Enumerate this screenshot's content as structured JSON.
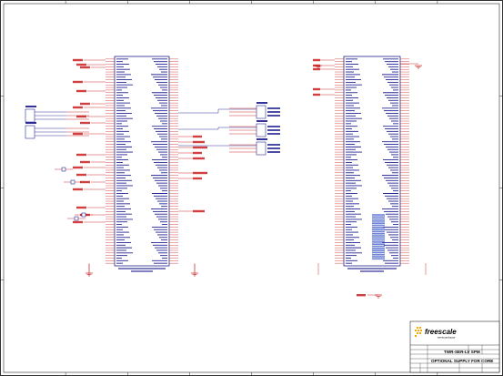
{
  "schematic": {
    "colors": {
      "border": "#000000",
      "net": "#c00000",
      "part_outline": "#000080",
      "pin_text": "#000080",
      "background": "#ffffff"
    },
    "zones": {
      "columns": [
        "1",
        "2",
        "3",
        "4",
        "5",
        "6",
        "7",
        "8"
      ],
      "rows": [
        "A",
        "B",
        "C",
        "D"
      ]
    },
    "title_block": {
      "company": "freescale",
      "company_sub": "semiconductor",
      "title": "TWR-SER-LV SPM",
      "subtitle": "OPTIONAL SUPPLY FOR CORE"
    }
  }
}
